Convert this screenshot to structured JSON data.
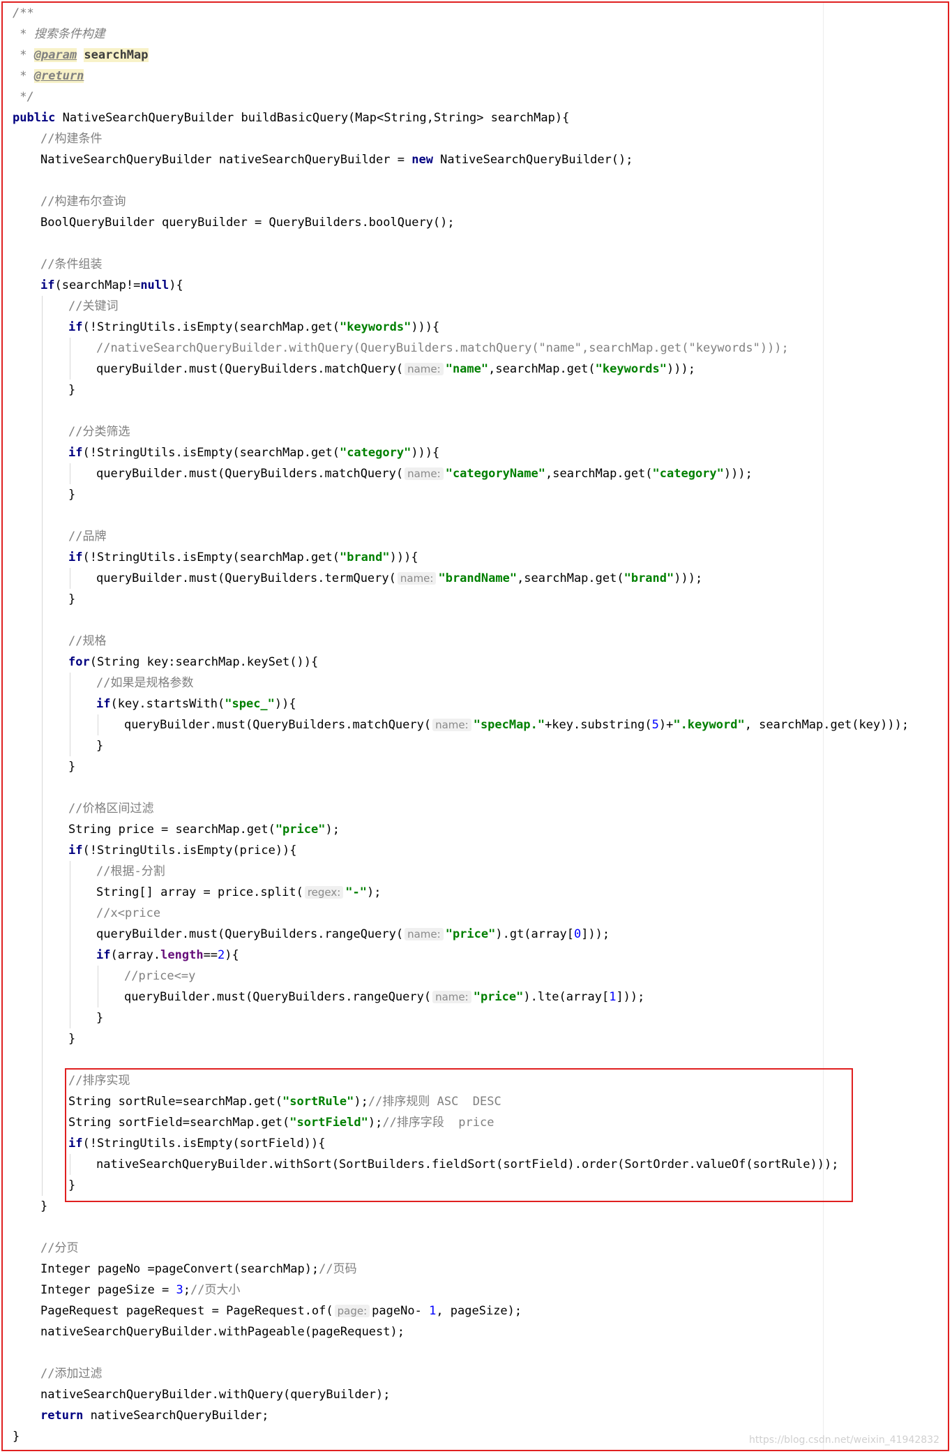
{
  "watermark": "https://blog.csdn.net/weixin_41942832",
  "code_lines": [
    {
      "indent": 0,
      "tokens": [
        {
          "t": "/**",
          "c": "cmt-doc"
        }
      ]
    },
    {
      "indent": 0,
      "tokens": [
        {
          "t": " * 搜索条件构建",
          "c": "cmt-doc"
        }
      ]
    },
    {
      "indent": 0,
      "tokens": [
        {
          "t": " * ",
          "c": "cmt-doc"
        },
        {
          "t": "@param",
          "c": "tag"
        },
        {
          "t": " ",
          "c": "cmt-doc"
        },
        {
          "t": "searchMap",
          "c": "docparam"
        }
      ]
    },
    {
      "indent": 0,
      "tokens": [
        {
          "t": " * ",
          "c": "cmt-doc"
        },
        {
          "t": "@return",
          "c": "tag"
        }
      ]
    },
    {
      "indent": 0,
      "tokens": [
        {
          "t": " */",
          "c": "cmt-doc"
        }
      ]
    },
    {
      "indent": 0,
      "tokens": [
        {
          "t": "public",
          "c": "kw"
        },
        {
          "t": " NativeSearchQueryBuilder buildBasicQuery(Map<String,String> searchMap){"
        }
      ]
    },
    {
      "indent": 1,
      "tokens": [
        {
          "t": "//构建条件",
          "c": "cmt"
        }
      ]
    },
    {
      "indent": 1,
      "tokens": [
        {
          "t": "NativeSearchQueryBuilder nativeSearchQueryBuilder = "
        },
        {
          "t": "new",
          "c": "kw"
        },
        {
          "t": " NativeSearchQueryBuilder();"
        }
      ]
    },
    {
      "indent": 1,
      "tokens": []
    },
    {
      "indent": 1,
      "tokens": [
        {
          "t": "//构建布尔查询",
          "c": "cmt"
        }
      ]
    },
    {
      "indent": 1,
      "tokens": [
        {
          "t": "BoolQueryBuilder queryBuilder = QueryBuilders.boolQuery();"
        }
      ]
    },
    {
      "indent": 1,
      "tokens": []
    },
    {
      "indent": 1,
      "tokens": [
        {
          "t": "//条件组装",
          "c": "cmt"
        }
      ]
    },
    {
      "indent": 1,
      "tokens": [
        {
          "t": "if",
          "c": "kw"
        },
        {
          "t": "(searchMap!="
        },
        {
          "t": "null",
          "c": "kw"
        },
        {
          "t": "){"
        }
      ]
    },
    {
      "indent": 2,
      "tokens": [
        {
          "t": "//关键词",
          "c": "cmt"
        }
      ]
    },
    {
      "indent": 2,
      "tokens": [
        {
          "t": "if",
          "c": "kw"
        },
        {
          "t": "(!StringUtils.isEmpty(searchMap.get("
        },
        {
          "t": "\"keywords\"",
          "c": "str"
        },
        {
          "t": "))){"
        }
      ]
    },
    {
      "indent": 3,
      "tokens": [
        {
          "t": "//nativeSearchQueryBuilder.withQuery(QueryBuilders.matchQuery(\"name\",searchMap.get(\"keywords\")));",
          "c": "cmt"
        }
      ]
    },
    {
      "indent": 3,
      "tokens": [
        {
          "t": "queryBuilder.must(QueryBuilders.matchQuery("
        },
        {
          "t": "name:",
          "c": "hint"
        },
        {
          "t": "\"name\"",
          "c": "str"
        },
        {
          "t": ",searchMap.get("
        },
        {
          "t": "\"keywords\"",
          "c": "str"
        },
        {
          "t": ")));"
        }
      ]
    },
    {
      "indent": 2,
      "tokens": [
        {
          "t": "}"
        }
      ]
    },
    {
      "indent": 2,
      "tokens": []
    },
    {
      "indent": 2,
      "tokens": [
        {
          "t": "//分类筛选",
          "c": "cmt"
        }
      ]
    },
    {
      "indent": 2,
      "tokens": [
        {
          "t": "if",
          "c": "kw"
        },
        {
          "t": "(!StringUtils.isEmpty(searchMap.get("
        },
        {
          "t": "\"category\"",
          "c": "str"
        },
        {
          "t": "))){"
        }
      ]
    },
    {
      "indent": 3,
      "tokens": [
        {
          "t": "queryBuilder.must(QueryBuilders.matchQuery("
        },
        {
          "t": "name:",
          "c": "hint"
        },
        {
          "t": "\"categoryName\"",
          "c": "str"
        },
        {
          "t": ",searchMap.get("
        },
        {
          "t": "\"category\"",
          "c": "str"
        },
        {
          "t": ")));"
        }
      ]
    },
    {
      "indent": 2,
      "tokens": [
        {
          "t": "}"
        }
      ]
    },
    {
      "indent": 2,
      "tokens": []
    },
    {
      "indent": 2,
      "tokens": [
        {
          "t": "//品牌",
          "c": "cmt"
        }
      ]
    },
    {
      "indent": 2,
      "tokens": [
        {
          "t": "if",
          "c": "kw"
        },
        {
          "t": "(!StringUtils.isEmpty(searchMap.get("
        },
        {
          "t": "\"brand\"",
          "c": "str"
        },
        {
          "t": "))){"
        }
      ]
    },
    {
      "indent": 3,
      "tokens": [
        {
          "t": "queryBuilder.must(QueryBuilders.termQuery("
        },
        {
          "t": "name:",
          "c": "hint"
        },
        {
          "t": "\"brandName\"",
          "c": "str"
        },
        {
          "t": ",searchMap.get("
        },
        {
          "t": "\"brand\"",
          "c": "str"
        },
        {
          "t": ")));"
        }
      ]
    },
    {
      "indent": 2,
      "tokens": [
        {
          "t": "}"
        }
      ]
    },
    {
      "indent": 2,
      "tokens": []
    },
    {
      "indent": 2,
      "tokens": [
        {
          "t": "//规格",
          "c": "cmt"
        }
      ]
    },
    {
      "indent": 2,
      "tokens": [
        {
          "t": "for",
          "c": "kw"
        },
        {
          "t": "(String key:searchMap.keySet()){"
        }
      ]
    },
    {
      "indent": 3,
      "tokens": [
        {
          "t": "//如果是规格参数",
          "c": "cmt"
        }
      ]
    },
    {
      "indent": 3,
      "tokens": [
        {
          "t": "if",
          "c": "kw"
        },
        {
          "t": "(key.startsWith("
        },
        {
          "t": "\"spec_\"",
          "c": "str"
        },
        {
          "t": ")){"
        }
      ]
    },
    {
      "indent": 4,
      "tokens": [
        {
          "t": "queryBuilder.must(QueryBuilders.matchQuery("
        },
        {
          "t": "name:",
          "c": "hint"
        },
        {
          "t": "\"specMap.\"",
          "c": "str"
        },
        {
          "t": "+key.substring("
        },
        {
          "t": "5",
          "c": "num"
        },
        {
          "t": ")+"
        },
        {
          "t": "\".keyword\"",
          "c": "str"
        },
        {
          "t": ", searchMap.get(key)));"
        }
      ]
    },
    {
      "indent": 3,
      "tokens": [
        {
          "t": "}"
        }
      ]
    },
    {
      "indent": 2,
      "tokens": [
        {
          "t": "}"
        }
      ]
    },
    {
      "indent": 2,
      "tokens": []
    },
    {
      "indent": 2,
      "tokens": [
        {
          "t": "//价格区间过滤",
          "c": "cmt"
        }
      ]
    },
    {
      "indent": 2,
      "tokens": [
        {
          "t": "String price = searchMap.get("
        },
        {
          "t": "\"price\"",
          "c": "str"
        },
        {
          "t": ");"
        }
      ]
    },
    {
      "indent": 2,
      "tokens": [
        {
          "t": "if",
          "c": "kw"
        },
        {
          "t": "(!StringUtils.isEmpty(price)){"
        }
      ]
    },
    {
      "indent": 3,
      "tokens": [
        {
          "t": "//根据-分割",
          "c": "cmt"
        }
      ]
    },
    {
      "indent": 3,
      "tokens": [
        {
          "t": "String[] array = price.split("
        },
        {
          "t": "regex:",
          "c": "hint"
        },
        {
          "t": "\"-\"",
          "c": "str"
        },
        {
          "t": ");"
        }
      ]
    },
    {
      "indent": 3,
      "tokens": [
        {
          "t": "//x<price",
          "c": "cmt"
        }
      ]
    },
    {
      "indent": 3,
      "tokens": [
        {
          "t": "queryBuilder.must(QueryBuilders.rangeQuery("
        },
        {
          "t": "name:",
          "c": "hint"
        },
        {
          "t": "\"price\"",
          "c": "str"
        },
        {
          "t": ").gt(array["
        },
        {
          "t": "0",
          "c": "num"
        },
        {
          "t": "]));"
        }
      ]
    },
    {
      "indent": 3,
      "tokens": [
        {
          "t": "if",
          "c": "kw"
        },
        {
          "t": "(array."
        },
        {
          "t": "length",
          "c": "field"
        },
        {
          "t": "=="
        },
        {
          "t": "2",
          "c": "num"
        },
        {
          "t": "){"
        }
      ]
    },
    {
      "indent": 4,
      "tokens": [
        {
          "t": "//price<=y",
          "c": "cmt"
        }
      ]
    },
    {
      "indent": 4,
      "tokens": [
        {
          "t": "queryBuilder.must(QueryBuilders.rangeQuery("
        },
        {
          "t": "name:",
          "c": "hint"
        },
        {
          "t": "\"price\"",
          "c": "str"
        },
        {
          "t": ").lte(array["
        },
        {
          "t": "1",
          "c": "num"
        },
        {
          "t": "]));"
        }
      ]
    },
    {
      "indent": 3,
      "tokens": [
        {
          "t": "}"
        }
      ]
    },
    {
      "indent": 2,
      "tokens": [
        {
          "t": "}"
        }
      ]
    },
    {
      "indent": 2,
      "tokens": []
    },
    {
      "indent": 2,
      "tokens": [
        {
          "t": "//排序实现",
          "c": "cmt"
        }
      ]
    },
    {
      "indent": 2,
      "tokens": [
        {
          "t": "String sortRule=searchMap.get("
        },
        {
          "t": "\"sortRule\"",
          "c": "str"
        },
        {
          "t": ");"
        },
        {
          "t": "//排序规则 ASC  DESC",
          "c": "cmt"
        }
      ]
    },
    {
      "indent": 2,
      "tokens": [
        {
          "t": "String sortField=searchMap.get("
        },
        {
          "t": "\"sortField\"",
          "c": "str"
        },
        {
          "t": ");"
        },
        {
          "t": "//排序字段  price",
          "c": "cmt"
        }
      ]
    },
    {
      "indent": 2,
      "tokens": [
        {
          "t": "if",
          "c": "kw"
        },
        {
          "t": "(!StringUtils.isEmpty(sortField)){"
        }
      ]
    },
    {
      "indent": 3,
      "tokens": [
        {
          "t": "nativeSearchQueryBuilder.withSort(SortBuilders.fieldSort(sortField).order(SortOrder.valueOf(sortRule)));"
        }
      ]
    },
    {
      "indent": 2,
      "tokens": [
        {
          "t": "}"
        }
      ]
    },
    {
      "indent": 1,
      "tokens": [
        {
          "t": "}"
        }
      ]
    },
    {
      "indent": 1,
      "tokens": []
    },
    {
      "indent": 1,
      "tokens": [
        {
          "t": "//分页",
          "c": "cmt"
        }
      ]
    },
    {
      "indent": 1,
      "tokens": [
        {
          "t": "Integer pageNo =pageConvert(searchMap);"
        },
        {
          "t": "//页码",
          "c": "cmt"
        }
      ]
    },
    {
      "indent": 1,
      "tokens": [
        {
          "t": "Integer pageSize = "
        },
        {
          "t": "3",
          "c": "num"
        },
        {
          "t": ";"
        },
        {
          "t": "//页大小",
          "c": "cmt"
        }
      ]
    },
    {
      "indent": 1,
      "tokens": [
        {
          "t": "PageRequest pageRequest = PageRequest.of("
        },
        {
          "t": "page:",
          "c": "hint"
        },
        {
          "t": "pageNo- "
        },
        {
          "t": "1",
          "c": "num"
        },
        {
          "t": ", pageSize);"
        }
      ]
    },
    {
      "indent": 1,
      "tokens": [
        {
          "t": "nativeSearchQueryBuilder.withPageable(pageRequest);"
        }
      ]
    },
    {
      "indent": 1,
      "tokens": []
    },
    {
      "indent": 1,
      "tokens": [
        {
          "t": "//添加过滤",
          "c": "cmt"
        }
      ]
    },
    {
      "indent": 1,
      "tokens": [
        {
          "t": "nativeSearchQueryBuilder.withQuery(queryBuilder);"
        }
      ]
    },
    {
      "indent": 1,
      "tokens": [
        {
          "t": "return",
          "c": "kw"
        },
        {
          "t": " nativeSearchQueryBuilder;"
        }
      ]
    },
    {
      "indent": 0,
      "tokens": [
        {
          "t": "}"
        }
      ]
    }
  ]
}
